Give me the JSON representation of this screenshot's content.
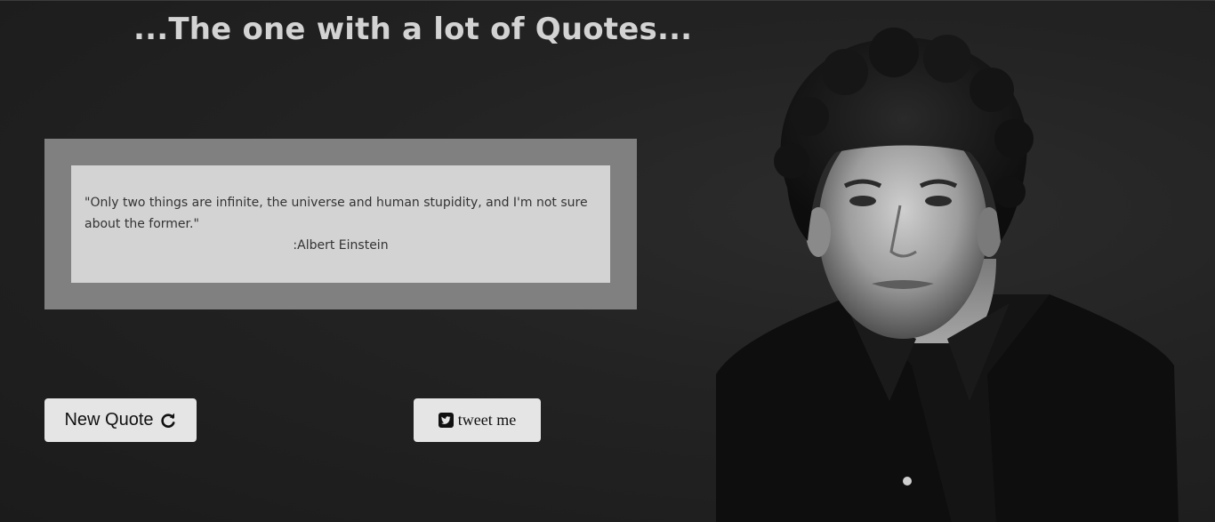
{
  "header": {
    "title": "...The one with a lot of Quotes..."
  },
  "quote": {
    "text": "\"Only two things are infinite, the universe and human stupidity, and I'm not sure about the former.\"",
    "author": ":Albert Einstein"
  },
  "buttons": {
    "new_quote_label": "New Quote",
    "new_quote_icon": "refresh-icon",
    "tweet_label": "tweet me",
    "tweet_icon": "twitter-square-icon"
  },
  "image": {
    "subject": "black-and-white portrait photo"
  },
  "colors": {
    "background": "#1f1f1f",
    "frame": "#808080",
    "card": "#d3d3d3",
    "button": "#e5e5e5",
    "title": "#d3d3d3"
  }
}
